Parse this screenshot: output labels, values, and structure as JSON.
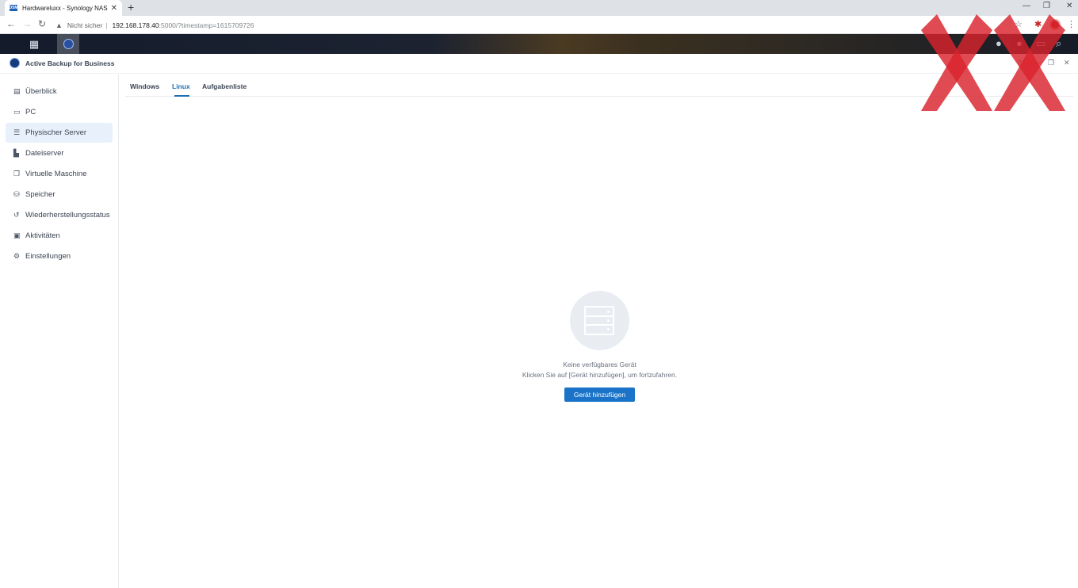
{
  "browser": {
    "tab_title": "Hardwareluxx - Synology NAS",
    "tab_favicon_text": "DSM",
    "tab_close": "✕",
    "new_tab": "+",
    "security_label": "Nicht sicher",
    "url_host": "192.168.178.40",
    "url_rest": ":5000/?timestamp=1615709726",
    "window_controls": {
      "minimize": "—",
      "restore": "❐",
      "close": "✕"
    },
    "nav": {
      "back": "←",
      "forward": "→",
      "reload": "↻"
    },
    "toolbar_icons": {
      "bookmark": "☆",
      "extension": "✱",
      "menu": "⋮"
    }
  },
  "app": {
    "title": "Active Backup for Business"
  },
  "sidebar": {
    "items": [
      {
        "label": "Überblick",
        "icon": "overview-icon",
        "glyph": "▤",
        "active": false
      },
      {
        "label": "PC",
        "icon": "pc-icon",
        "glyph": "▭",
        "active": false
      },
      {
        "label": "Physischer Server",
        "icon": "server-icon",
        "glyph": "☰",
        "active": true
      },
      {
        "label": "Dateiserver",
        "icon": "file-server-icon",
        "glyph": "▙",
        "active": false
      },
      {
        "label": "Virtuelle Maschine",
        "icon": "virtual-machine-icon",
        "glyph": "❐",
        "active": false
      },
      {
        "label": "Speicher",
        "icon": "storage-icon",
        "glyph": "⛁",
        "active": false
      },
      {
        "label": "Wiederherstellungsstatus",
        "icon": "restore-status-icon",
        "glyph": "↺",
        "active": false
      },
      {
        "label": "Aktivitäten",
        "icon": "activities-icon",
        "glyph": "▣",
        "active": false
      },
      {
        "label": "Einstellungen",
        "icon": "settings-icon",
        "glyph": "⚙",
        "active": false
      }
    ]
  },
  "tabs": [
    {
      "label": "Windows",
      "active": false
    },
    {
      "label": "Linux",
      "active": true
    },
    {
      "label": "Aufgabenliste",
      "active": false
    }
  ],
  "empty_state": {
    "title": "Keine verfügbares Gerät",
    "hint": "Klicken Sie auf [Gerät hinzufügen], um fortzufahren.",
    "button": "Gerät hinzufügen"
  },
  "colors": {
    "accent": "#1a73c8",
    "active_tab": "#1f6fb5",
    "sidebar_active_bg": "#e8f0fb",
    "watermark": "#d9232d"
  }
}
